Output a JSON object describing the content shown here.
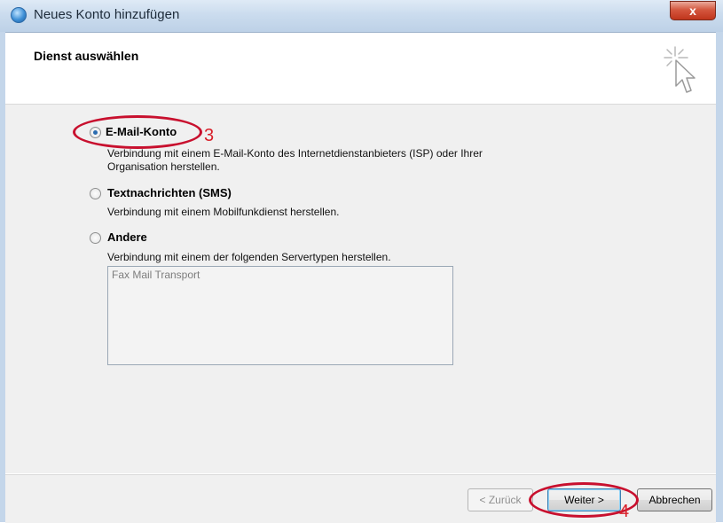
{
  "window": {
    "title": "Neues Konto hinzufügen",
    "close_glyph": "x"
  },
  "header": {
    "title": "Dienst auswählen",
    "icon": "wizard-cursor-sparkle-icon"
  },
  "options": [
    {
      "label": "E-Mail-Konto",
      "description_line1": "Verbindung mit einem E-Mail-Konto des Internetdienstanbieters (ISP) oder Ihrer",
      "description_line2": "Organisation herstellen.",
      "selected": true
    },
    {
      "label": "Textnachrichten (SMS)",
      "description_line1": "Verbindung mit einem Mobilfunkdienst herstellen.",
      "selected": false
    },
    {
      "label": "Andere",
      "description_line1": "Verbindung mit einem der folgenden Servertypen herstellen.",
      "selected": false
    }
  ],
  "server_types": [
    "Fax Mail Transport"
  ],
  "buttons": {
    "back": "< Zurück",
    "next": "Weiter >",
    "cancel": "Abbrechen"
  },
  "annotations": {
    "step_email": "3",
    "step_next": "4",
    "color": "#c8102e"
  }
}
